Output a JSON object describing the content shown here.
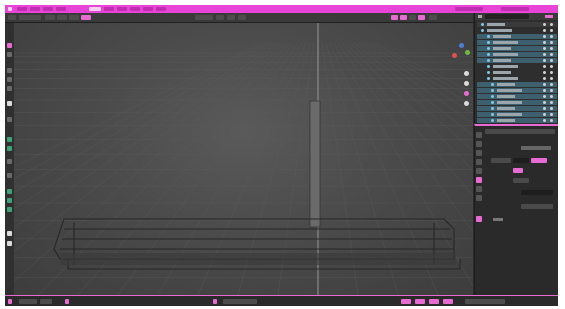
{
  "window": {
    "app_title": ""
  },
  "colors": {
    "accent": "#e844d8",
    "highlight": "#e86bd4",
    "panel_bg": "#2b2b2b",
    "viewport_bg": "#4b4b4b",
    "selection": "#3d5f6e",
    "outliner_icon": "#7fc8e8",
    "gizmo_x": "#e05050",
    "gizmo_y": "#70b840",
    "gizmo_z": "#4a7fd8"
  },
  "top_menu": {
    "items": [
      "",
      "",
      "",
      "",
      "",
      "",
      "",
      "",
      "",
      "",
      "",
      ""
    ]
  },
  "viewport_header": {
    "mode": "",
    "view": ""
  },
  "toolbar": {
    "tools": [
      "move-tool-icon",
      "rotate-tool-icon",
      "scale-tool-icon",
      "transform-tool-icon",
      "annotate-tool-icon",
      "measure-tool-icon",
      "add-tool-icon"
    ]
  },
  "viewport": {
    "overlay_lines": [
      "",
      "",
      ""
    ],
    "stats": [
      "",
      "",
      "",
      "",
      ""
    ],
    "gizmo_axes": [
      "x-axis-icon",
      "y-axis-icon",
      "z-axis-icon"
    ]
  },
  "outliner": {
    "rows": [
      "",
      "",
      "",
      "",
      "",
      "",
      "",
      "",
      "",
      "",
      "",
      "",
      "",
      "",
      "",
      "",
      ""
    ]
  },
  "properties": {
    "title": "",
    "fields": [
      "",
      "",
      "",
      "",
      ""
    ]
  },
  "status_bar": {
    "left": "",
    "center": "",
    "right": ""
  }
}
